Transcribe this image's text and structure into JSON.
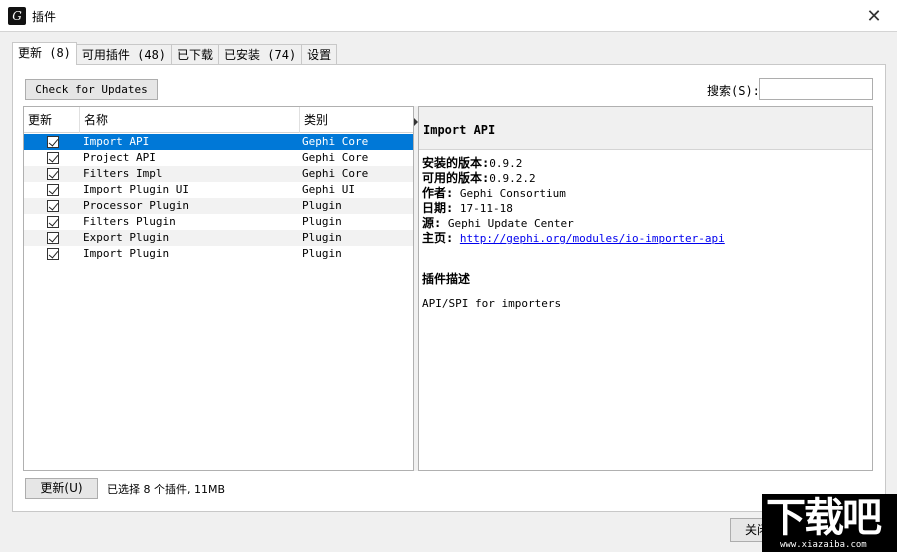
{
  "window": {
    "title": "插件",
    "app_icon_glyph": "G"
  },
  "tabs": [
    {
      "label": "更新 (8)",
      "active": true
    },
    {
      "label": "可用插件 (48)"
    },
    {
      "label": "已下载"
    },
    {
      "label": "已安装 (74)"
    },
    {
      "label": "设置"
    }
  ],
  "toolbar": {
    "check_updates_label": "Check for Updates",
    "search_label": "搜索(S):",
    "search_value": ""
  },
  "list": {
    "columns": [
      "更新",
      "名称",
      "类别"
    ],
    "rows": [
      {
        "name": "Import API",
        "category": "Gephi Core",
        "checked": true,
        "selected": true
      },
      {
        "name": "Project API",
        "category": "Gephi Core",
        "checked": true
      },
      {
        "name": "Filters Impl",
        "category": "Gephi Core",
        "checked": true
      },
      {
        "name": "Import Plugin UI",
        "category": "Gephi UI",
        "checked": true
      },
      {
        "name": "Processor Plugin",
        "category": "Plugin",
        "checked": true
      },
      {
        "name": "Filters Plugin",
        "category": "Plugin",
        "checked": true
      },
      {
        "name": "Export Plugin",
        "category": "Plugin",
        "checked": true
      },
      {
        "name": "Import Plugin",
        "category": "Plugin",
        "checked": true
      }
    ]
  },
  "detail": {
    "title": "Import API",
    "installed_label": "安装的版本:",
    "installed_value": "0.9.2",
    "available_label": "可用的版本:",
    "available_value": "0.9.2.2",
    "author_label": "作者:",
    "author_value": " Gephi Consortium",
    "date_label": "日期:",
    "date_value": " 17-11-18",
    "source_label": "源:",
    "source_value": " Gephi Update Center",
    "homepage_label": "主页:",
    "homepage_value": "http://gephi.org/modules/io-importer-api",
    "description_title": "插件描述",
    "description_text": "API/SPI for importers"
  },
  "footer": {
    "update_button": "更新(U)",
    "selection_status": "已选择 8 个插件, 11MB",
    "close_button": "关闭"
  },
  "watermark": {
    "big": "下载吧",
    "small": "www.xiazaiba.com"
  }
}
